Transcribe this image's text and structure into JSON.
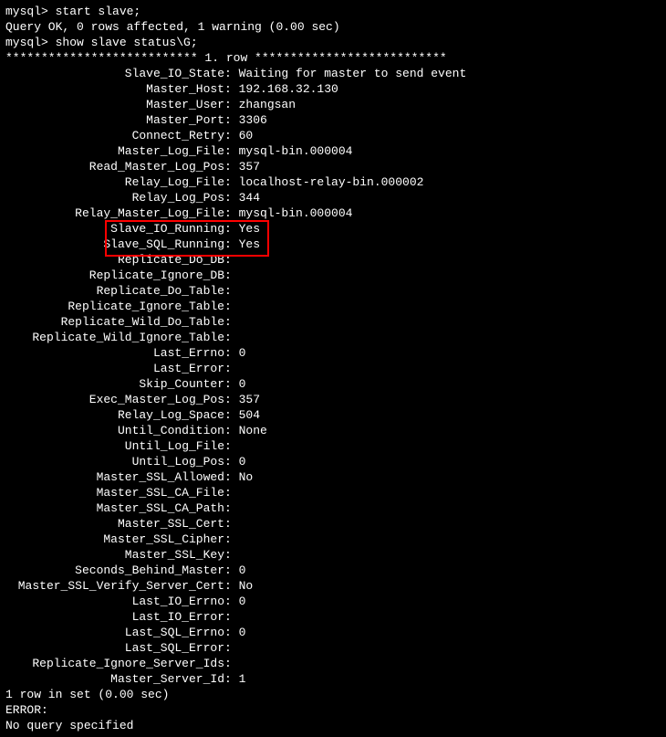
{
  "lines": {
    "prompt1": "mysql> start slave;",
    "result1": "Query OK, 0 rows affected, 1 warning (0.00 sec)",
    "blank1": "",
    "prompt2": "mysql> show slave status\\G;",
    "rowHeader": "*************************** 1. row ***************************",
    "rowsInSet": "1 row in set (0.00 sec)",
    "blank2": "",
    "errorLabel": "ERROR:",
    "noQuery": "No query specified"
  },
  "status": [
    {
      "k": "Slave_IO_State",
      "v": "Waiting for master to send event"
    },
    {
      "k": "Master_Host",
      "v": "192.168.32.130"
    },
    {
      "k": "Master_User",
      "v": "zhangsan"
    },
    {
      "k": "Master_Port",
      "v": "3306"
    },
    {
      "k": "Connect_Retry",
      "v": "60"
    },
    {
      "k": "Master_Log_File",
      "v": "mysql-bin.000004"
    },
    {
      "k": "Read_Master_Log_Pos",
      "v": "357"
    },
    {
      "k": "Relay_Log_File",
      "v": "localhost-relay-bin.000002"
    },
    {
      "k": "Relay_Log_Pos",
      "v": "344"
    },
    {
      "k": "Relay_Master_Log_File",
      "v": "mysql-bin.000004"
    },
    {
      "k": "Slave_IO_Running",
      "v": "Yes",
      "hl": true
    },
    {
      "k": "Slave_SQL_Running",
      "v": "Yes",
      "hl": true
    },
    {
      "k": "Replicate_Do_DB",
      "v": ""
    },
    {
      "k": "Replicate_Ignore_DB",
      "v": ""
    },
    {
      "k": "Replicate_Do_Table",
      "v": ""
    },
    {
      "k": "Replicate_Ignore_Table",
      "v": ""
    },
    {
      "k": "Replicate_Wild_Do_Table",
      "v": ""
    },
    {
      "k": "Replicate_Wild_Ignore_Table",
      "v": ""
    },
    {
      "k": "Last_Errno",
      "v": "0"
    },
    {
      "k": "Last_Error",
      "v": ""
    },
    {
      "k": "Skip_Counter",
      "v": "0"
    },
    {
      "k": "Exec_Master_Log_Pos",
      "v": "357"
    },
    {
      "k": "Relay_Log_Space",
      "v": "504"
    },
    {
      "k": "Until_Condition",
      "v": "None"
    },
    {
      "k": "Until_Log_File",
      "v": ""
    },
    {
      "k": "Until_Log_Pos",
      "v": "0"
    },
    {
      "k": "Master_SSL_Allowed",
      "v": "No"
    },
    {
      "k": "Master_SSL_CA_File",
      "v": ""
    },
    {
      "k": "Master_SSL_CA_Path",
      "v": ""
    },
    {
      "k": "Master_SSL_Cert",
      "v": ""
    },
    {
      "k": "Master_SSL_Cipher",
      "v": ""
    },
    {
      "k": "Master_SSL_Key",
      "v": ""
    },
    {
      "k": "Seconds_Behind_Master",
      "v": "0"
    },
    {
      "k": "Master_SSL_Verify_Server_Cert",
      "v": "No"
    },
    {
      "k": "Last_IO_Errno",
      "v": "0"
    },
    {
      "k": "Last_IO_Error",
      "v": ""
    },
    {
      "k": "Last_SQL_Errno",
      "v": "0"
    },
    {
      "k": "Last_SQL_Error",
      "v": ""
    },
    {
      "k": "Replicate_Ignore_Server_Ids",
      "v": ""
    },
    {
      "k": "Master_Server_Id",
      "v": "1"
    }
  ],
  "highlight": {
    "color": "#ff0000"
  }
}
